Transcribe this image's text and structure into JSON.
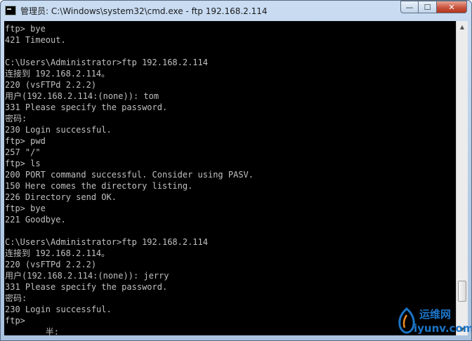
{
  "window": {
    "title": "管理员: C:\\Windows\\system32\\cmd.exe - ftp  192.168.2.114",
    "controls": {
      "minimize": "—",
      "maximize": "☐",
      "close": "✕"
    }
  },
  "console": {
    "lines": [
      "ftp> bye",
      "421 Timeout.",
      "",
      "C:\\Users\\Administrator>ftp 192.168.2.114",
      "连接到 192.168.2.114。",
      "220 (vsFTPd 2.2.2)",
      "用户(192.168.2.114:(none)): tom",
      "331 Please specify the password.",
      "密码:",
      "230 Login successful.",
      "ftp> pwd",
      "257 \"/\"",
      "ftp> ls",
      "200 PORT command successful. Consider using PASV.",
      "150 Here comes the directory listing.",
      "226 Directory send OK.",
      "ftp> bye",
      "221 Goodbye.",
      "",
      "C:\\Users\\Administrator>ftp 192.168.2.114",
      "连接到 192.168.2.114。",
      "220 (vsFTPd 2.2.2)",
      "用户(192.168.2.114:(none)): jerry",
      "331 Please specify the password.",
      "密码:",
      "230 Login successful.",
      "ftp>",
      "        半:"
    ]
  },
  "scrollbar": {
    "up_arrow": "▲",
    "down_arrow": "▼"
  },
  "watermark": {
    "cn_text": "运维网",
    "en_text": "iyunv.com"
  },
  "colors": {
    "console_bg": "#000000",
    "console_fg": "#c0c0c0",
    "close_button": "#c8553f",
    "watermark": "#1b75c8"
  }
}
